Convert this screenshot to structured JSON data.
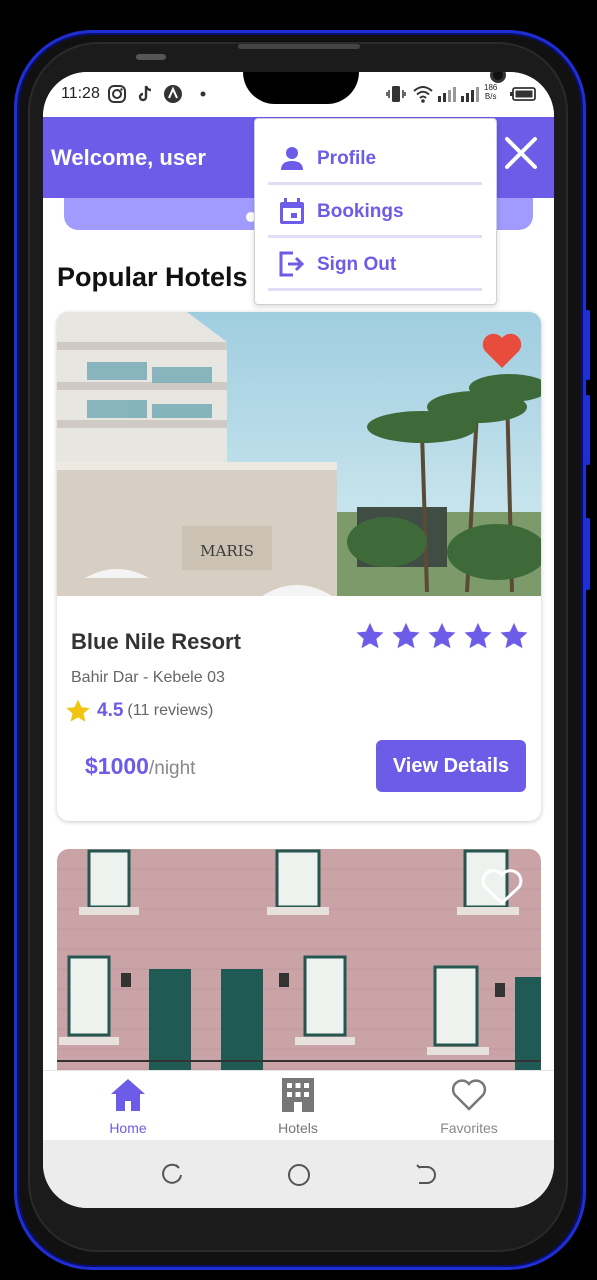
{
  "status_bar": {
    "time": "11:28",
    "net_speed_top": "186",
    "net_speed_bottom": "B/s"
  },
  "header": {
    "welcome": "Welcome, user"
  },
  "menu": {
    "items": [
      {
        "label": "Profile",
        "icon": "person-icon"
      },
      {
        "label": "Bookings",
        "icon": "calendar-icon"
      },
      {
        "label": "Sign Out",
        "icon": "logout-icon"
      }
    ]
  },
  "section": {
    "title": "Popular Hotels"
  },
  "hotels": [
    {
      "name": "Blue Nile Resort",
      "location": "Bahir Dar - Kebele 03",
      "rating": "4.5",
      "reviews": "(11 reviews)",
      "stars": 5,
      "price": "$1000",
      "per_night": "/night",
      "button": "View Details",
      "favorited": true
    },
    {
      "favorited": false
    }
  ],
  "bottom_nav": [
    {
      "label": "Home",
      "icon": "home-icon",
      "active": true
    },
    {
      "label": "Hotels",
      "icon": "building-icon",
      "active": false
    },
    {
      "label": "Favorites",
      "icon": "heart-outline-icon",
      "active": false
    }
  ],
  "colors": {
    "accent": "#6c5ce7",
    "accent_light": "#a29bfe",
    "heart": "#e74c3c",
    "star": "#f1c40f"
  }
}
